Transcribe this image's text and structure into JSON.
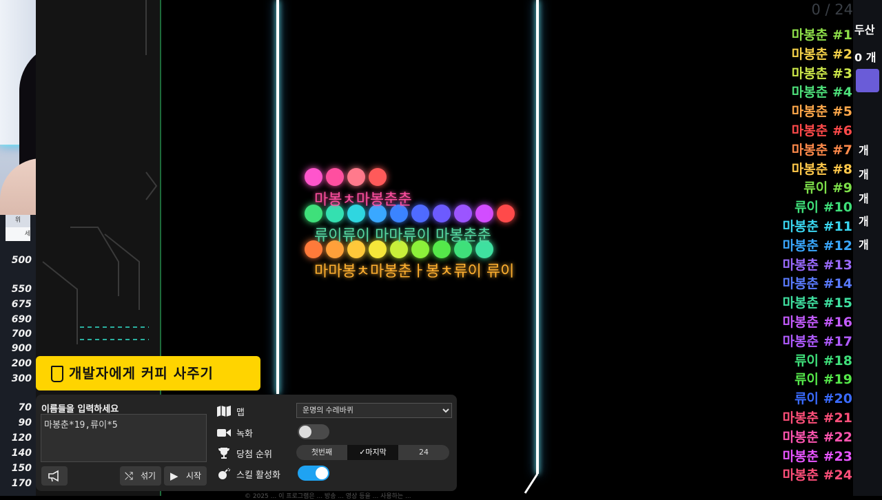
{
  "counter": "0 / 24",
  "left_strip": {
    "top1": "위",
    "top2": "세",
    "items": [
      "500",
      "550",
      "675",
      "690",
      "700",
      "900",
      "200",
      "300",
      "70",
      "90",
      "120",
      "140",
      "150",
      "170"
    ]
  },
  "right_edge": [
    "두산",
    "0 개",
    "개",
    "개",
    "개",
    "개",
    "개"
  ],
  "marbles": [
    {
      "color": "#ff55cc"
    },
    {
      "color": "#ff4fa0"
    },
    {
      "color": "#ff7a8c"
    },
    {
      "color": "#ff5a5a"
    },
    {
      "color": "#3fe07a"
    },
    {
      "color": "#34e0b0"
    },
    {
      "color": "#2fd6e0"
    },
    {
      "color": "#3aa8ff"
    },
    {
      "color": "#3b84ff"
    },
    {
      "color": "#4f6bff"
    },
    {
      "color": "#6c5bff"
    },
    {
      "color": "#9b55ff"
    },
    {
      "color": "#d24dff"
    },
    {
      "color": "#ff4a4a"
    },
    {
      "color": "#ff7a3a"
    },
    {
      "color": "#ffa03a"
    },
    {
      "color": "#ffc83a"
    },
    {
      "color": "#f5e63a"
    },
    {
      "color": "#c8f03a"
    },
    {
      "color": "#8cf03a"
    },
    {
      "color": "#55e84a"
    },
    {
      "color": "#3fe07a"
    },
    {
      "color": "#3fe0a0"
    }
  ],
  "marble_labels": [
    {
      "text": "마봉ㅊ마봉춘춘",
      "color": "#ff4fa0"
    },
    {
      "text": "류이류이 마마류이 마봉춘춘",
      "color": "#55d6a0"
    },
    {
      "text": "마마봉ㅊ마봉춘ㅏ봉ㅊ류이 류이",
      "color": "#ffb030"
    }
  ],
  "ranking": [
    {
      "label": "마봉춘 #1",
      "color": "#8fe04a"
    },
    {
      "label": "마봉춘 #2",
      "color": "#f5d24a"
    },
    {
      "label": "마봉춘 #3",
      "color": "#cde84a"
    },
    {
      "label": "마봉춘 #4",
      "color": "#4ee07a"
    },
    {
      "label": "마봉춘 #5",
      "color": "#ffa84a"
    },
    {
      "label": "마봉춘 #6",
      "color": "#ff4a4a"
    },
    {
      "label": "마봉춘 #7",
      "color": "#ff8a4a"
    },
    {
      "label": "마봉춘 #8",
      "color": "#ffc84a"
    },
    {
      "label": "류이 #9",
      "color": "#7ee04a"
    },
    {
      "label": "류이 #10",
      "color": "#3fe07a"
    },
    {
      "label": "마봉춘 #11",
      "color": "#3ad6f0"
    },
    {
      "label": "마봉춘 #12",
      "color": "#3aa8ff"
    },
    {
      "label": "마봉춘 #13",
      "color": "#9b6bff"
    },
    {
      "label": "마봉춘 #14",
      "color": "#5a7bff"
    },
    {
      "label": "마봉춘 #15",
      "color": "#3fe0a0"
    },
    {
      "label": "마봉춘 #16",
      "color": "#c55bff"
    },
    {
      "label": "마봉춘 #17",
      "color": "#b05bff"
    },
    {
      "label": "류이 #18",
      "color": "#3fe07a"
    },
    {
      "label": "류이 #19",
      "color": "#55e84a"
    },
    {
      "label": "류이 #20",
      "color": "#3a6bff"
    },
    {
      "label": "마봉춘 #21",
      "color": "#ff4f7a"
    },
    {
      "label": "마봉춘 #22",
      "color": "#ff55b0"
    },
    {
      "label": "마봉춘 #23",
      "color": "#e855ff"
    },
    {
      "label": "마봉춘 #24",
      "color": "#ff4f7a"
    }
  ],
  "coffee": {
    "label": "개발자에게 커피 사주기"
  },
  "panel": {
    "name_label": "이름들을 입력하세요",
    "name_value": "마봉춘*19,류이*5",
    "shuffle_label": "섞기",
    "start_label": "시작",
    "map_label": "맵",
    "map_value": "운명의 수레바퀴",
    "record_label": "녹화",
    "record_on": false,
    "rank_label": "당첨 순위",
    "rank_options": [
      "첫번째",
      "마지막",
      "24"
    ],
    "rank_selected": "마지막",
    "skill_label": "스킬 활성화",
    "skill_on": true
  },
  "footer": "© 2025 ... 이 프로그램은 ... 방송 ... 영상 등을 ... 사용하는 ..."
}
